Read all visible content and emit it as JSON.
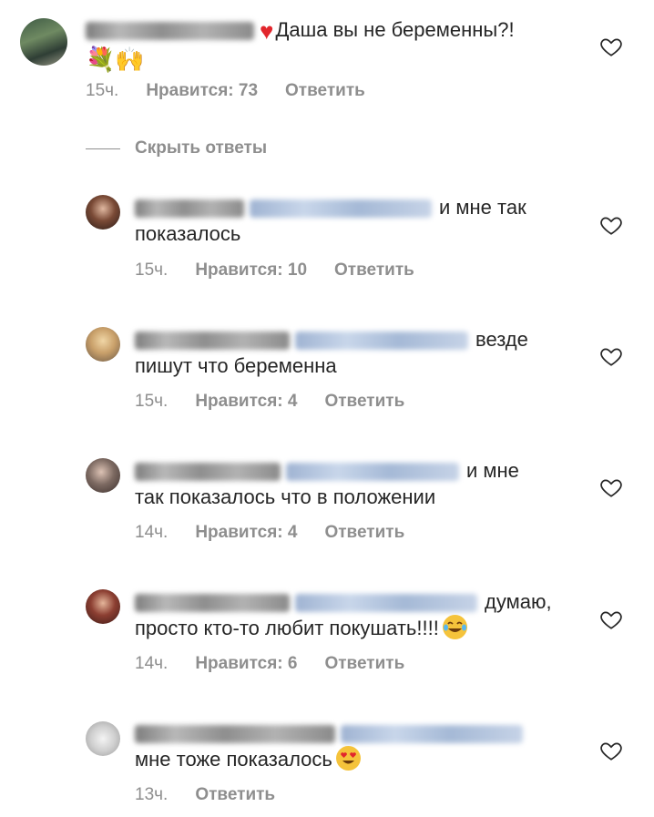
{
  "main_comment": {
    "text": "Даша вы не беременны?!",
    "emoji_line": "💐🙌",
    "time": "15ч.",
    "likes": "Нравится: 73",
    "reply": "Ответить"
  },
  "hide_replies": "Скрыть ответы",
  "replies": [
    {
      "line1": "и мне так",
      "line2": "показалось",
      "time": "15ч.",
      "likes": "Нравится: 10",
      "reply": "Ответить"
    },
    {
      "line1": "везде",
      "line2": "пишут что беременна",
      "time": "15ч.",
      "likes": "Нравится: 4",
      "reply": "Ответить"
    },
    {
      "line1": "и мне",
      "line2": "так показалось что в положении",
      "time": "14ч.",
      "likes": "Нравится: 4",
      "reply": "Ответить"
    },
    {
      "line1": "думаю,",
      "line2": "просто кто-то любит покушать!!!!",
      "time": "14ч.",
      "likes": "Нравится: 6",
      "reply": "Ответить"
    },
    {
      "line1": "",
      "line2": "мне тоже показалось",
      "time": "13ч.",
      "reply": "Ответить"
    }
  ],
  "icons": {
    "like": "heart-outline-icon",
    "inline_heart": "red-heart-icon",
    "laughing": "tears-of-joy-emoji",
    "heart_eyes": "heart-eyes-emoji"
  }
}
